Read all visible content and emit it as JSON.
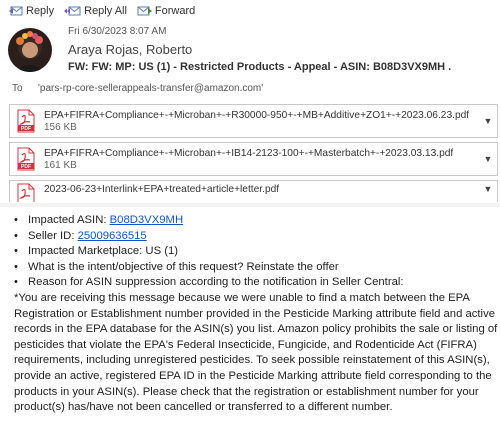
{
  "toolbar": {
    "reply": "Reply",
    "reply_all": "Reply All",
    "forward": "Forward"
  },
  "header": {
    "date": "Fri 6/30/2023 8:07 AM",
    "sender": "Araya Rojas, Roberto",
    "subject": "FW: FW: MP: US (1) - Restricted Products - Appeal - ASIN:   B08D3VX9MH ."
  },
  "recipients": {
    "to_label": "To",
    "to_address": "'pars-rp-core-sellerappeals-transfer@amazon.com'"
  },
  "attachments": [
    {
      "name": "EPA+FIFRA+Compliance+-+Microban+-+R30000-950+-+MB+Additive+ZO1+-+2023.06.23.pdf",
      "size": "156 KB"
    },
    {
      "name": "EPA+FIFRA+Compliance+-+Microban+-+IB14-2123-100+-+Masterbatch+-+2023.03.13.pdf",
      "size": "161 KB"
    },
    {
      "name": "2023-06-23+Interlink+EPA+treated+article+letter.pdf",
      "size": ""
    }
  ],
  "body": {
    "bullets": {
      "asin_label": "Impacted ASIN: ",
      "asin_value": "B08D3VX9MH",
      "seller_label": "Seller ID:  ",
      "seller_value": "25009636515",
      "marketplace": "Impacted Marketplace: US (1)",
      "intent": "What is the intent/objective of this request? Reinstate the offer",
      "reason": "Reason for ASIN suppression according to the notification in Seller Central:"
    },
    "paragraph": "*You are receiving this message because we were unable to find a match between the EPA Registration or Establishment number provided in the Pesticide Marking attribute field and active records in the EPA database for the ASIN(s) you list. Amazon policy prohibits the sale or listing of pesticides that violate the EPA's Federal Insecticide, Fungicide, and Rodenticide Act (FIFRA) requirements, including unregistered pesticides. To seek possible reinstatement of this ASIN(s), provide an active, registered EPA ID in the Pesticide Marking attribute field corresponding to the products in your ASIN(s). Please check that the registration or establishment number for your product(s) has/have not been cancelled or transferred to a different number."
  },
  "colors": {
    "link": "#1155cc",
    "pdf_red": "#d13438"
  },
  "icons": {
    "reply": "reply-icon",
    "reply_all": "reply-all-icon",
    "forward": "forward-icon",
    "pdf": "pdf-file-icon",
    "chevron": "chevron-down-icon"
  }
}
